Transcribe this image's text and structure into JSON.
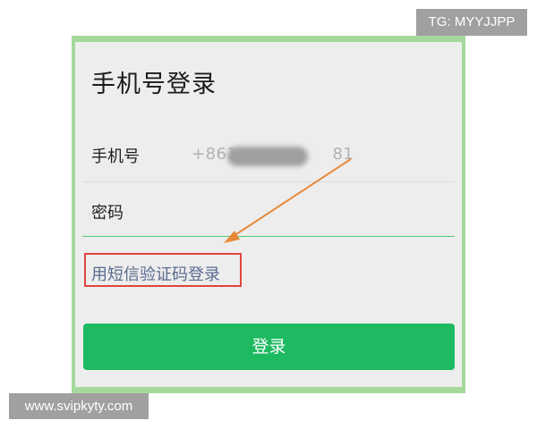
{
  "page": {
    "title": "手机号登录"
  },
  "form": {
    "phone_label": "手机号",
    "phone_value_prefix": "+861",
    "phone_value_suffix": "81",
    "password_label": "密码",
    "password_value": ""
  },
  "sms_login_link": "用短信验证码登录",
  "login_button": "登录",
  "watermarks": {
    "top_right": "TG: MYYJJPP",
    "bottom_left": "www.svipkyty.com"
  },
  "colors": {
    "accent_green": "#1eba62",
    "highlight_red": "#e0463b",
    "arrow_orange": "#e8893a"
  }
}
